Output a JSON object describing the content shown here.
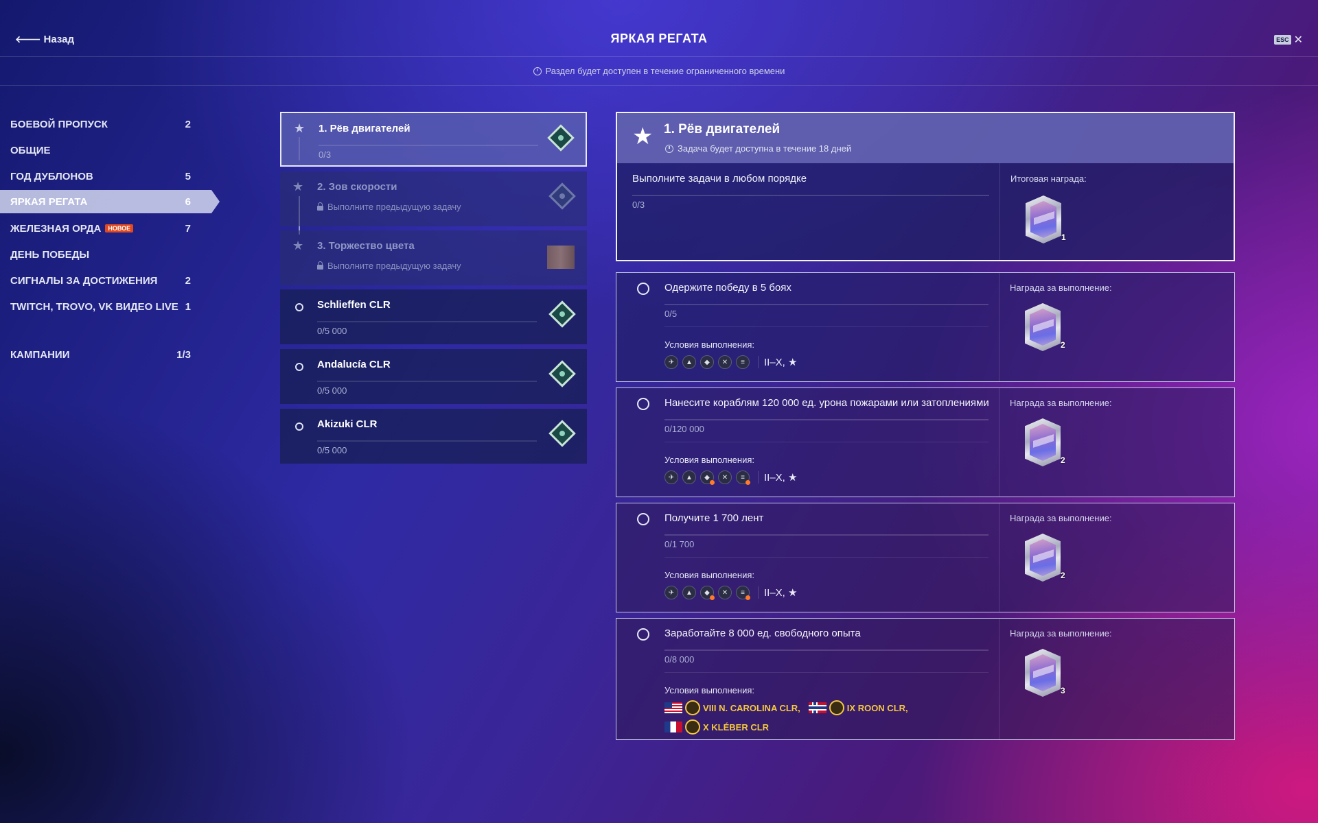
{
  "header": {
    "back_label": "Назад",
    "title": "ЯРКАЯ РЕГАТА",
    "esc_label": "ESC",
    "close_symbol": "✕",
    "notice": "Раздел будет доступен в течение ограниченного времени"
  },
  "sidebar": {
    "items": [
      {
        "label": "БОЕВОЙ ПРОПУСК",
        "count": "2"
      },
      {
        "label": "ОБЩИЕ",
        "count": ""
      },
      {
        "label": "ГОД ДУБЛОНОВ",
        "count": "5"
      },
      {
        "label": "ЯРКАЯ РЕГАТА",
        "count": "6",
        "active": true
      },
      {
        "label": "ЖЕЛЕЗНАЯ ОРДА",
        "badge": "НОВОЕ",
        "count": "7"
      },
      {
        "label": "ДЕНЬ ПОБЕДЫ",
        "count": ""
      },
      {
        "label": "СИГНАЛЫ ЗА ДОСТИЖЕНИЯ",
        "count": "2"
      },
      {
        "label": "TWITCH, TROVO, VK ВИДЕО LIVE",
        "count": "1"
      }
    ],
    "campaigns": {
      "label": "КАМПАНИИ",
      "count": "1/3"
    }
  },
  "tasks": [
    {
      "name": "1. Рёв двигателей",
      "progress": "0/3",
      "state": "selected",
      "icon": "star-icon",
      "reward_icon": "diamond-icon"
    },
    {
      "name": "2. Зов скорости",
      "locked_text": "Выполните предыдущую задачу",
      "state": "locked",
      "icon": "star-icon",
      "reward_icon": "diamond-icon"
    },
    {
      "name": "3. Торжество цвета",
      "locked_text": "Выполните предыдущую задачу",
      "state": "locked",
      "icon": "star-icon",
      "reward_icon": "flag-item-icon"
    },
    {
      "name": "Schlieffen CLR",
      "progress": "0/5 000",
      "state": "normal",
      "icon": "circle-icon",
      "reward_icon": "diamond-icon"
    },
    {
      "name": "Andalucía CLR",
      "progress": "0/5 000",
      "state": "normal",
      "icon": "circle-icon",
      "reward_icon": "diamond-icon"
    },
    {
      "name": "Akizuki CLR",
      "progress": "0/5 000",
      "state": "normal",
      "icon": "circle-icon",
      "reward_icon": "diamond-icon"
    }
  ],
  "detail": {
    "title": "1. Рёв двигателей",
    "subtitle": "Задача будет доступна в течение 18 дней",
    "instruction": "Выполните задачи в любом порядке",
    "progress": "0/3",
    "final_reward_label": "Итоговая награда:",
    "final_reward_count": "1",
    "reward_label": "Награда за выполнение:",
    "conditions_label": "Условия выполнения:",
    "objectives": [
      {
        "title": "Одержите победу в 5 боях",
        "progress": "0/5",
        "tiers": "II–X, ★",
        "reward_count": "2",
        "class_icons": [
          "aircraft-carrier-icon",
          "battleship-icon",
          "cruiser-icon",
          "destroyer-icon",
          "submarine-icon"
        ]
      },
      {
        "title": "Нанесите кораблям 120 000 ед. урона пожарами или затоплениями",
        "progress": "0/120 000",
        "tiers": "II–X, ★",
        "reward_count": "2",
        "class_icons": [
          "aircraft-carrier-icon",
          "battleship-icon",
          "cruiser-icon",
          "destroyer-icon",
          "submarine-icon"
        ]
      },
      {
        "title": "Получите 1 700 лент",
        "progress": "0/1 700",
        "tiers": "II–X, ★",
        "reward_count": "2",
        "class_icons": [
          "aircraft-carrier-icon",
          "battleship-icon",
          "cruiser-icon",
          "destroyer-icon",
          "submarine-icon"
        ]
      },
      {
        "title": "Заработайте 8 000 ед. свободного опыта",
        "progress": "0/8 000",
        "reward_count": "3",
        "ships": [
          {
            "flag": "us-flag-icon",
            "name": "VIII N. CAROLINA CLR,"
          },
          {
            "flag": "norway-flag-icon",
            "name": "IX ROON CLR,"
          },
          {
            "flag": "france-flag-icon",
            "name": "X KLÉBER CLR"
          }
        ]
      }
    ]
  },
  "colors": {
    "accent_orange": "#e0491f",
    "ship_gold": "#f4c93e",
    "selected_bg": "#5a5faf"
  }
}
